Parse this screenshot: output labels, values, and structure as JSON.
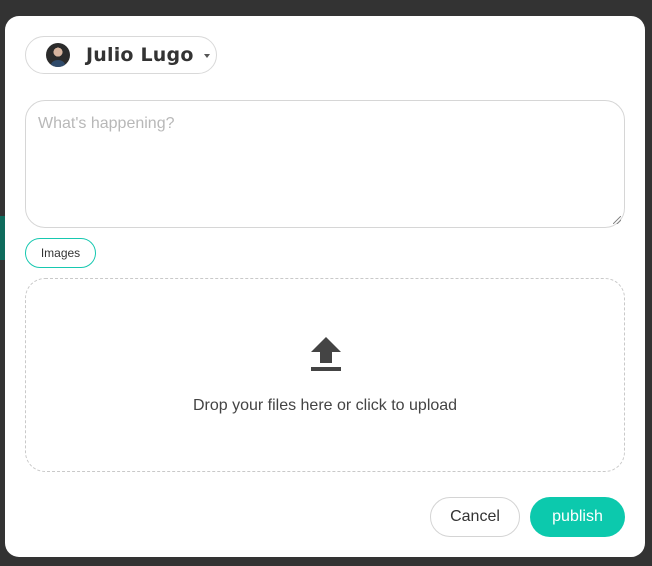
{
  "composer": {
    "user": {
      "name": "Julio Lugo",
      "avatar_icon": "user-avatar",
      "dropdown_icon": "caret-down-icon"
    },
    "text_input": {
      "placeholder": "What's happening?",
      "value": ""
    },
    "media_tab": {
      "label": "Images",
      "active": true
    },
    "dropzone": {
      "icon": "upload-icon",
      "text": "Drop your files here or click to upload"
    },
    "actions": {
      "cancel_label": "Cancel",
      "publish_label": "publish"
    },
    "colors": {
      "accent": "#0cc9ad",
      "active_border": "#17c8b0",
      "backdrop": "#333333"
    }
  }
}
